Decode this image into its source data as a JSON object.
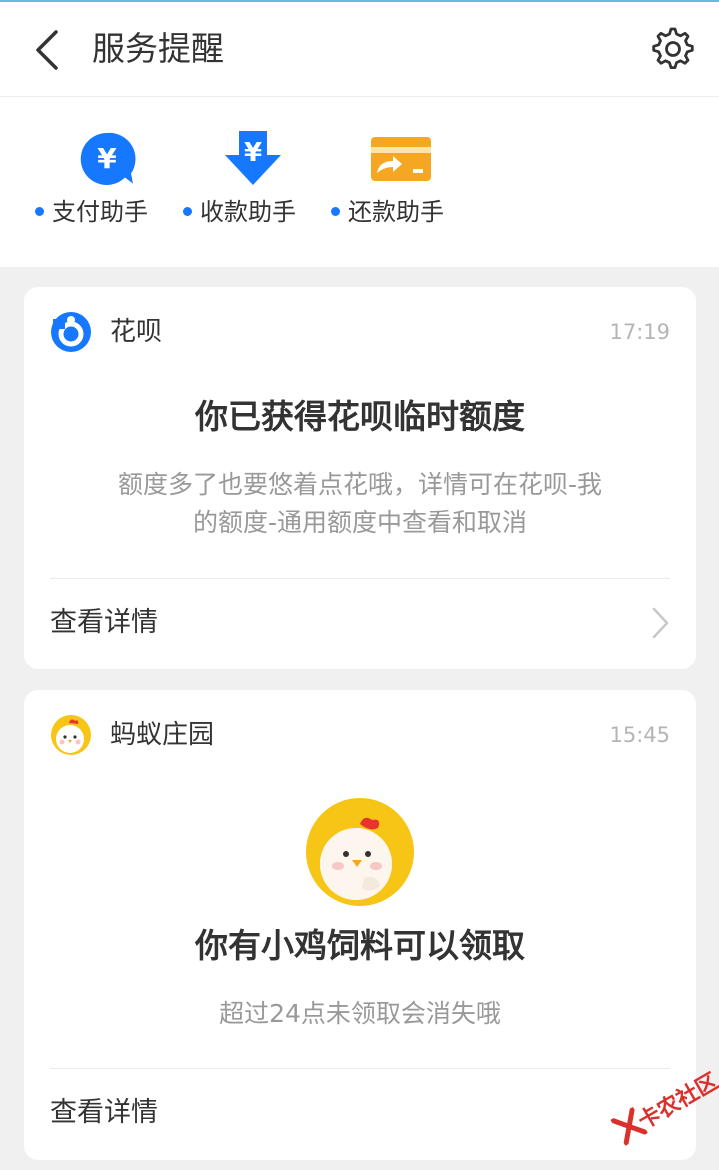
{
  "header": {
    "title": "服务提醒"
  },
  "helpers": [
    {
      "label": "支付助手",
      "icon": "yuan-bubble-icon",
      "color": "#1677ff"
    },
    {
      "label": "收款助手",
      "icon": "yuan-download-icon",
      "color": "#1677ff"
    },
    {
      "label": "还款助手",
      "icon": "card-repay-icon",
      "color": "#f5a623"
    }
  ],
  "cards": [
    {
      "source": "花呗",
      "time": "17:19",
      "title": "你已获得花呗临时额度",
      "desc_line1": "额度多了也要悠着点花哦，详情可在花呗-我",
      "desc_line2": "的额度-通用额度中查看和取消",
      "link": "查看详情"
    },
    {
      "source": "蚂蚁庄园",
      "time": "15:45",
      "title": "你有小鸡饲料可以领取",
      "desc": "超过24点未领取会消失哦",
      "link": "查看详情"
    }
  ],
  "watermark": "卡农社区",
  "colors": {
    "accent": "#1677ff",
    "repay": "#f5a623",
    "chick_bg": "#f7c515"
  }
}
